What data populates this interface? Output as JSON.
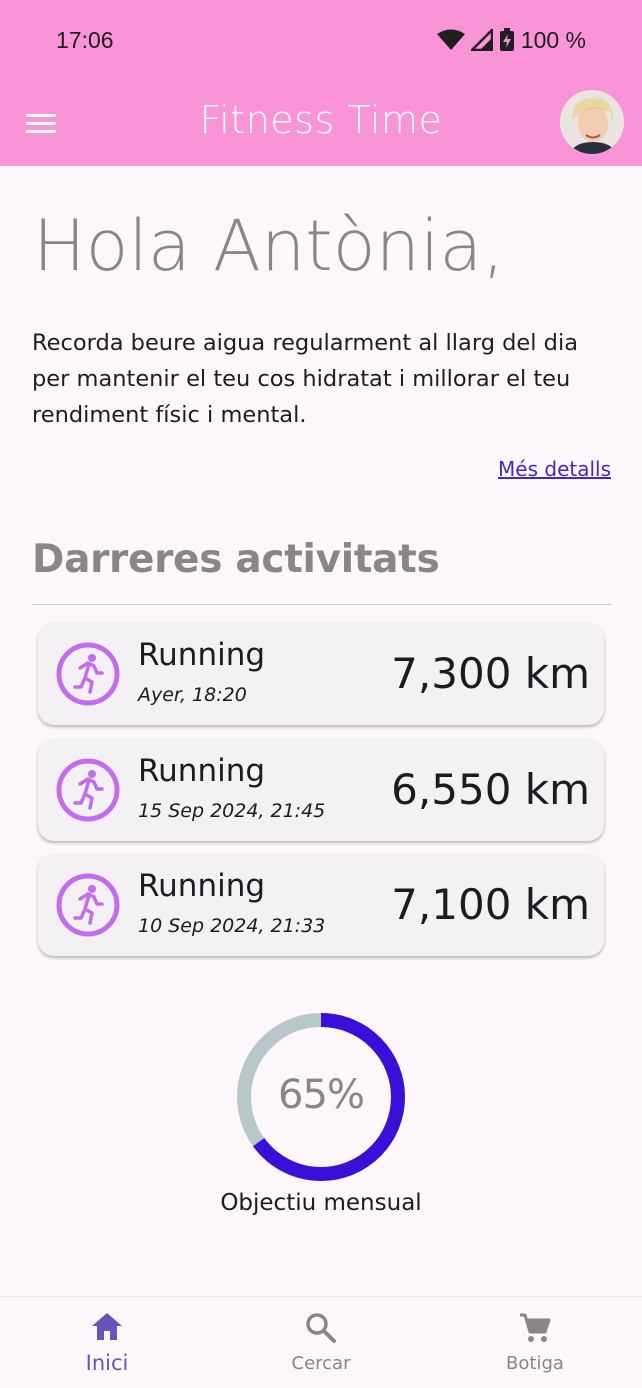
{
  "status_bar": {
    "time": "17:06",
    "battery": "100 %",
    "icons": [
      "wifi-icon",
      "signal-icon",
      "battery-charging-icon"
    ]
  },
  "app_bar": {
    "title": "Fitness Time",
    "menu_icon": "menu-icon",
    "avatar": "user-avatar"
  },
  "home": {
    "greeting": "Hola Antònia,",
    "tip": "Recorda beure aigua regularment al llarg del dia per mantenir el teu cos hidratat i millorar el teu rendiment físic i mental.",
    "more_link": "Més detalls",
    "section_title": "Darreres activitats"
  },
  "activities": [
    {
      "name": "Running",
      "date": "Ayer, 18:20",
      "distance": "7,300 km",
      "icon": "running-icon"
    },
    {
      "name": "Running",
      "date": "15 Sep 2024, 21:45",
      "distance": "6,550 km",
      "icon": "running-icon"
    },
    {
      "name": "Running",
      "date": "10 Sep 2024, 21:33",
      "distance": "7,100 km",
      "icon": "running-icon"
    }
  ],
  "goal": {
    "percent_label": "65%",
    "progress": 0.65,
    "label": "Objectiu mensual",
    "progress_color": "#3a0fd8",
    "track_color": "#b8c7ca"
  },
  "bottom_nav": {
    "items": [
      {
        "label": "Inici",
        "icon": "home-icon",
        "active": true
      },
      {
        "label": "Cercar",
        "icon": "search-icon",
        "active": false
      },
      {
        "label": "Botiga",
        "icon": "cart-icon",
        "active": false
      }
    ]
  },
  "colors": {
    "brand": "#f994d6",
    "accent": "#c46cf0",
    "link": "#3b2bc8"
  }
}
